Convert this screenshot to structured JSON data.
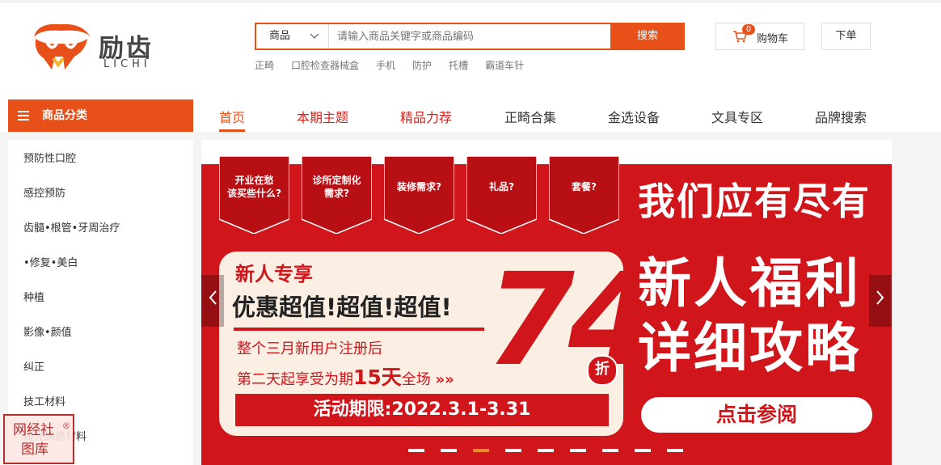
{
  "logo": {
    "cn": "励齿",
    "en": "LICHI"
  },
  "search": {
    "category": "商品",
    "placeholder": "请输入商品关键字或商品编码",
    "button": "搜索"
  },
  "hot_keywords": [
    "正畸",
    "口腔检查器械盒",
    "手机",
    "防护",
    "托槽",
    "霸道车针"
  ],
  "cart": {
    "label": "购物车",
    "count": "0"
  },
  "order": {
    "label": "下单"
  },
  "category_bar": {
    "label": "商品分类"
  },
  "tabs": [
    "首页",
    "本期主题",
    "精品力荐",
    "正畸合集",
    "金选设备",
    "文具专区",
    "品牌搜索"
  ],
  "sidebar": {
    "items": [
      "预防性口腔",
      "感控预防",
      "齿髓•根管•牙周治疗",
      "•修复•美白",
      "种植",
      "影像•颜值",
      "纠正",
      "技工材料",
      "抛光研磨材料"
    ]
  },
  "banner": {
    "flags": [
      "开业在愁\n该买些什么?",
      "诊所定制化\n需求?",
      "装修需求?",
      "礼品?",
      "套餐?"
    ],
    "headline": "我们应有尽有",
    "card_title": "新人专享",
    "card_slogan": "优惠超值!超值!超值!",
    "card_line1": "整个三月新用户注册后",
    "card_line2_pre": "第二天起享受为期",
    "card_line2_days": "15天",
    "card_line2_post": "全场",
    "discount_num": "74",
    "discount_unit": "折",
    "period": "活动期限:2022.3.1-3.31",
    "big1": "新人福利",
    "big2": "详细攻略",
    "cta": "点击参阅",
    "slide_count": 9,
    "active_slide": 3
  },
  "watermark": {
    "line1": "网经社",
    "line2": "图库",
    "mark": "®"
  },
  "colors": {
    "accent": "#e8501a",
    "banner_red": "#d0161b",
    "tab_red": "#d9221c"
  }
}
